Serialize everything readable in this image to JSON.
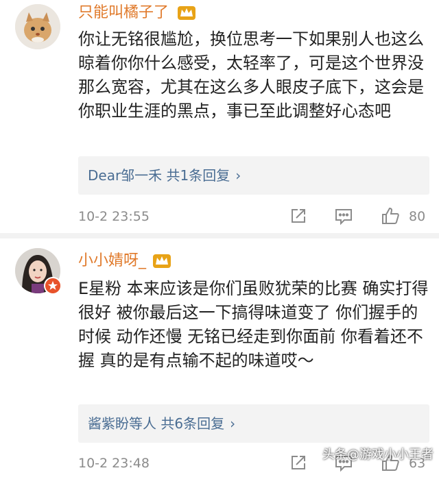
{
  "comments": [
    {
      "username": "只能叫橘子了",
      "text": "你让无铭很尴尬，换位思考一下如果别人也这么晾着你你什么感受，太轻率了，可是这个世界没那么宽容，尤其在这么多人眼皮子底下，这会是你职业生涯的黑点，事已至此调整好心态吧",
      "reply_summary": "Dear邹一禾 共1条回复",
      "time": "10-2 23:55",
      "likes": "80"
    },
    {
      "username": "小小婧呀_",
      "text": "E星粉 本来应该是你们虽败犹荣的比赛 确实打得很好 被你最后这一下搞得味道变了 你们握手的时候 动作还慢 无铭已经走到你面前 你看着还不握 真的是有点输不起的味道哎～",
      "reply_summary": "酱紫盼等人 共6条回复",
      "time": "10-2 23:48",
      "likes": "63"
    }
  ],
  "watermark": "头条@游戏小小王者",
  "colors": {
    "username": "#e07a2b",
    "link": "#4a6d93",
    "meta": "#8b8b8b",
    "crown": "#e8a317"
  },
  "icons": [
    "crown-icon",
    "share-icon",
    "comment-icon",
    "like-icon",
    "chevron-right-icon",
    "verified-badge-icon"
  ]
}
